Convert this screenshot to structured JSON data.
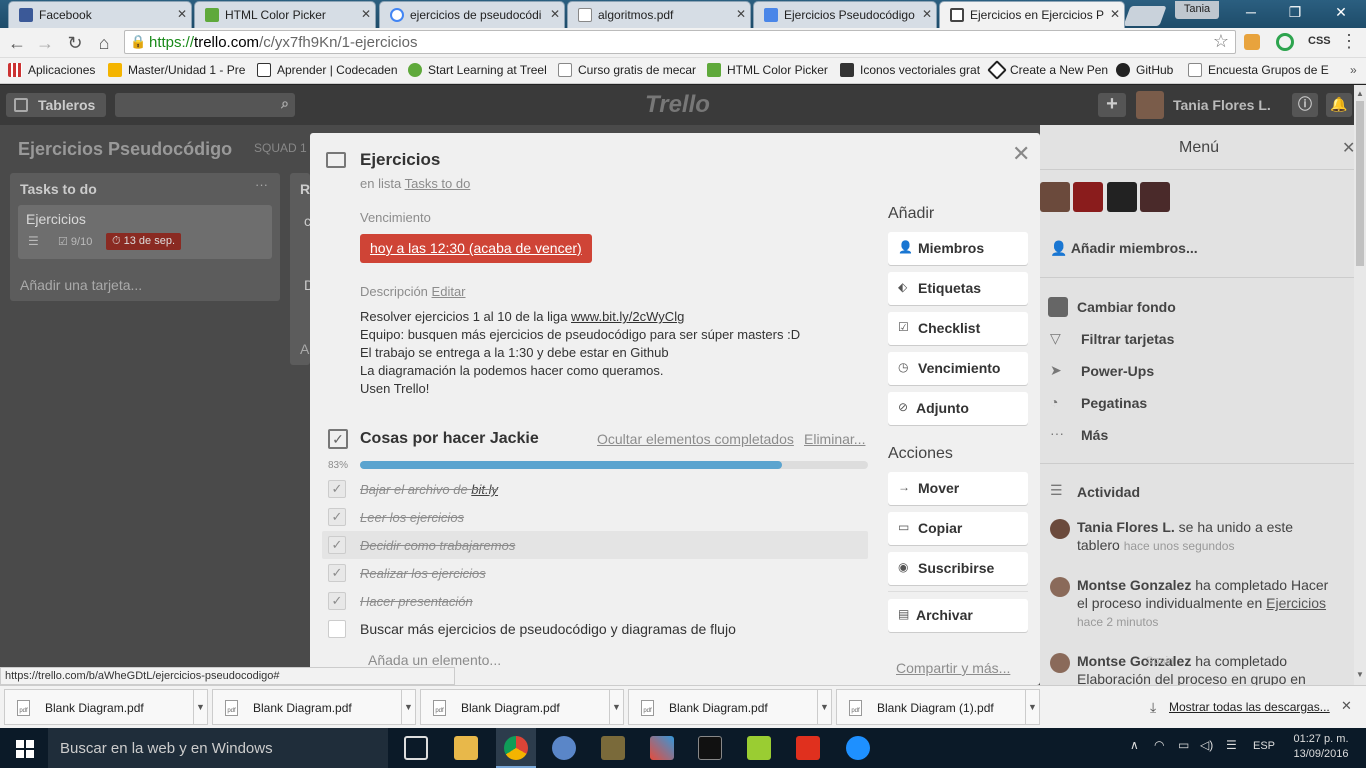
{
  "browser": {
    "tabs": [
      {
        "title": "Facebook",
        "color": "#3b5998"
      },
      {
        "title": "HTML Color Picker",
        "color": "#5fa93b"
      },
      {
        "title": "ejercicios de pseudocódi",
        "color": "#ffffff"
      },
      {
        "title": "algoritmos.pdf",
        "color": "#ffffff"
      },
      {
        "title": "Ejercicios Pseudocódigo",
        "color": "#4a86e8"
      },
      {
        "title": "Ejercicios en Ejercicios P",
        "color": "#ffffff"
      }
    ],
    "user": "Tania",
    "url_scheme": "https://",
    "url_host": "trello.com",
    "url_path": "/c/yx7fh9Kn/1-ejercicios",
    "extension_label": "CSS",
    "bookmarks": [
      "Aplicaciones",
      "Master/Unidad 1 - Pre",
      "Aprender | Codecaden",
      "Start Learning at Treel",
      "Curso gratis de mecar",
      "HTML Color Picker",
      "Iconos vectoriales grat",
      "Create a New Pen",
      "GitHub",
      "Encuesta Grupos de E"
    ],
    "status_url": "https://trello.com/b/aWheGDtL/ejercicios-pseudocodigo#"
  },
  "trello": {
    "boards_label": "Tableros",
    "logo": "Trello",
    "user_name": "Tania Flores L.",
    "board_title": "Ejercicios Pseudocódigo",
    "board_team": "SQUAD 1",
    "lists": [
      {
        "title": "Tasks to do",
        "card_title": "Ejercicios",
        "checklist_count": "9/10",
        "due": "13 de sep.",
        "add_card": "Añadir una tarjeta..."
      }
    ],
    "list2_initial": "R",
    "list2_chars": [
      "c",
      "D",
      "A"
    ]
  },
  "card": {
    "title": "Ejercicios",
    "in_list_prefix": "en lista",
    "list_name": "Tasks to do",
    "due_label": "Vencimiento",
    "due_value": "hoy a las 12:30 (acaba de vencer)",
    "desc_label": "Descripción",
    "desc_edit": "Editar",
    "description": [
      "Resolver ejercicios 1 al 10 de la liga",
      "www.bit.ly/2cWyClg",
      "Equipo: busquen más ejercicios de pseudocódigo para ser súper masters :D",
      "El trabajo se entrega a la 1:30 y debe estar en Github",
      "La diagramación la podemos hacer como queramos.",
      "Usen Trello!"
    ],
    "checklist": {
      "title": "Cosas por hacer Jackie",
      "hide_link": "Ocultar elementos completados",
      "delete_link": "Eliminar...",
      "progress_label": "83%",
      "progress": 0.83,
      "items": [
        {
          "prefix": "Bajar el archivo de ",
          "link": "bit.ly",
          "done": true
        },
        {
          "prefix": "Leer los ejercicios",
          "link": "",
          "done": true
        },
        {
          "prefix": "Decidir como trabajaremos",
          "link": "",
          "done": true
        },
        {
          "prefix": "Realizar los ejercicios",
          "link": "",
          "done": true
        },
        {
          "prefix": "Hacer presentación",
          "link": "",
          "done": true
        },
        {
          "prefix": "Buscar más ejercicios de pseudocódigo y diagramas de flujo",
          "link": "",
          "done": false
        }
      ],
      "add_item": "Añada un elemento..."
    },
    "add_heading": "Añadir",
    "add_buttons": [
      "Miembros",
      "Etiquetas",
      "Checklist",
      "Vencimiento",
      "Adjunto"
    ],
    "actions_heading": "Acciones",
    "action_buttons": [
      "Mover",
      "Copiar",
      "Suscribirse",
      "Archivar"
    ],
    "share_link": "Compartir y más..."
  },
  "menu": {
    "title": "Menú",
    "add_members": "Añadir miembros...",
    "items": [
      "Cambiar fondo",
      "Filtrar tarjetas",
      "Power-Ups",
      "Pegatinas",
      "Más"
    ],
    "activity_title": "Actividad",
    "activity": [
      {
        "user": "Tania Flores L.",
        "text": " se ha unido a este tablero",
        "link": "",
        "time": "hace unos segundos"
      },
      {
        "user": "Montse Gonzalez",
        "text": " ha completado Hacer el proceso individualmente en ",
        "link": "Ejercicios",
        "time": "hace 2 minutos"
      },
      {
        "user": "Montse Gonzalez",
        "text": " ha completado Elaboración del proceso en grupo en",
        "link": "",
        "time": ""
      }
    ],
    "map_label": "Spain"
  },
  "downloads": {
    "files": [
      "Blank Diagram.pdf",
      "Blank Diagram.pdf",
      "Blank Diagram.pdf",
      "Blank Diagram.pdf",
      "Blank Diagram (1).pdf"
    ],
    "show_all": "Mostrar todas las descargas..."
  },
  "taskbar": {
    "search": "Buscar en la web y en Windows",
    "lang": "ESP",
    "time": "01:27 p. m.",
    "date": "13/09/2016"
  }
}
